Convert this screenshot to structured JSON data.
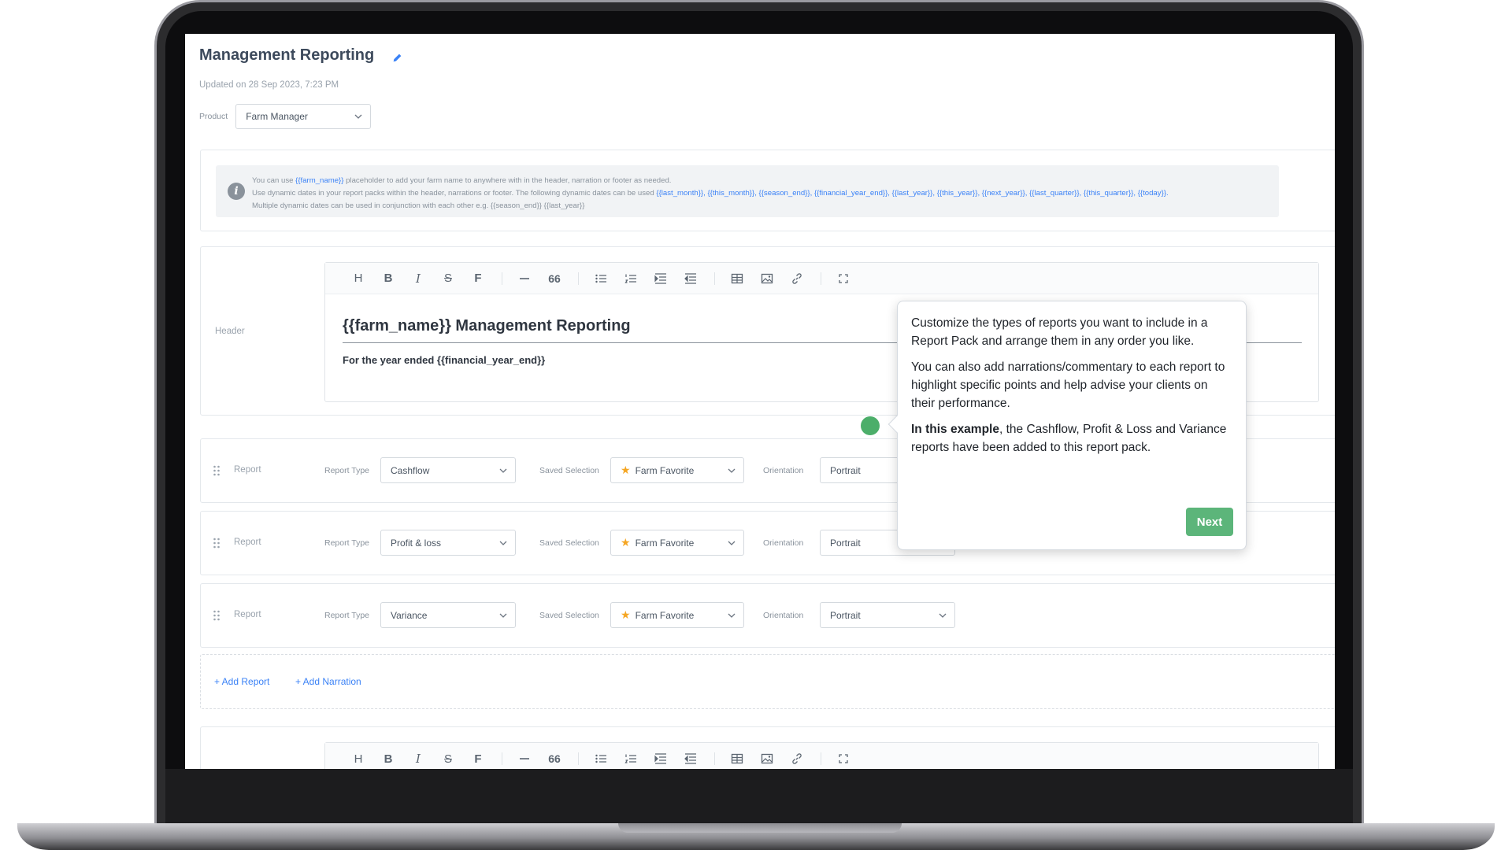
{
  "page": {
    "title": "Management Reporting",
    "updated": "Updated on 28 Sep 2023, 7:23 PM",
    "product_label": "Product",
    "product_value": "Farm Manager"
  },
  "info": {
    "line1_a": "You can use ",
    "line1_ph": "{{farm_name}}",
    "line1_b": " placeholder to add your farm name to anywhere with in the header, narration or footer as needed.",
    "line2_a": "Use dynamic dates in your report packs within the header, narrations or footer. The following dynamic dates can be used ",
    "line2_ph": "{{last_month}}, {{this_month}}, {{season_end}}, {{financial_year_end}}, {{last_year}}, {{this_year}}, {{next_year}}, {{last_quarter}}, {{this_quarter}}, {{today}}.",
    "line3": "Multiple dynamic dates can be used in conjunction with each other e.g. {{season_end}} {{last_year}}"
  },
  "header_section": {
    "label": "Header",
    "heading": "{{farm_name}} Management Reporting",
    "subheading": "For the year ended {{financial_year_end}}"
  },
  "toolbar": {
    "heading": "H",
    "bold": "B",
    "italic": "I",
    "strike": "S",
    "font": "F",
    "quote": "66"
  },
  "reports": [
    {
      "label": "Report",
      "type_label": "Report Type",
      "type": "Cashflow",
      "saved_label": "Saved Selection",
      "saved": "Farm Favorite",
      "orientation_label": "Orientation",
      "orientation": "Portrait"
    },
    {
      "label": "Report",
      "type_label": "Report Type",
      "type": "Profit & loss",
      "saved_label": "Saved Selection",
      "saved": "Farm Favorite",
      "orientation_label": "Orientation",
      "orientation": "Portrait"
    },
    {
      "label": "Report",
      "type_label": "Report Type",
      "type": "Variance",
      "saved_label": "Saved Selection",
      "saved": "Farm Favorite",
      "orientation_label": "Orientation",
      "orientation": "Portrait"
    }
  ],
  "actions": {
    "add_report": "+ Add Report",
    "add_narration": "+ Add Narration"
  },
  "popover": {
    "p1": "Customize the types of reports you want to include in a Report Pack and arrange them in any order you like.",
    "p2": "You can also add narrations/commentary to each report to highlight specific points and help advise your clients on their performance.",
    "p3_bold": "In this example",
    "p3_rest": ", the Cashflow, Profit & Loss and Variance reports have been added to this report pack.",
    "next": "Next"
  },
  "colors": {
    "accent": "#3b82f6",
    "tour_green": "#5cb57a",
    "star": "#f5a623"
  }
}
